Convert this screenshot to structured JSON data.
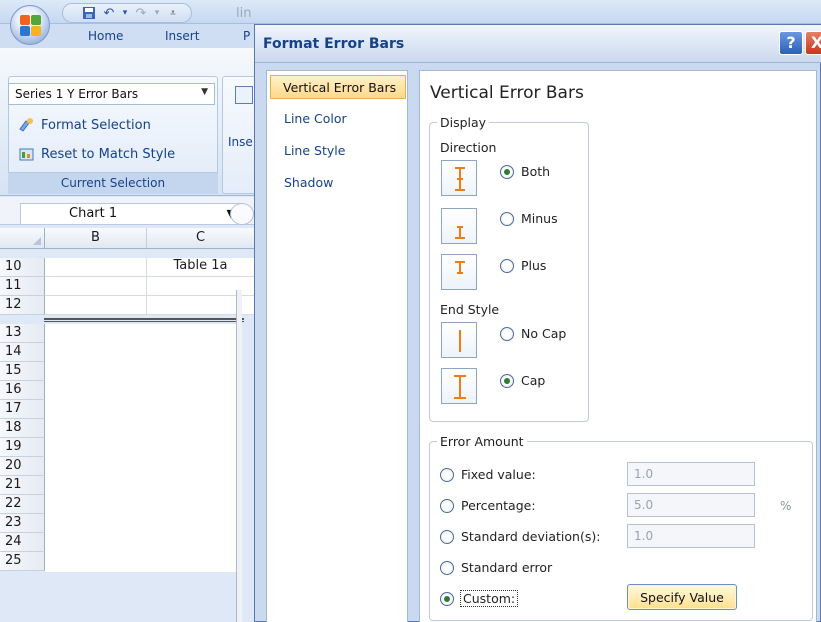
{
  "excel": {
    "doc_title": "lin",
    "tabs": [
      "Home",
      "Insert",
      "P"
    ],
    "current_selection": {
      "dropdown_value": "Series 1 Y Error Bars",
      "format_selection": "Format Selection",
      "reset_style": "Reset to Match Style",
      "group_label": "Current Selection"
    },
    "insert_label": "Inse",
    "name_box": "Chart 1",
    "columns": [
      "B",
      "C"
    ],
    "rows": [
      "10",
      "11",
      "12",
      "13",
      "14",
      "15",
      "16",
      "17",
      "18",
      "19",
      "20",
      "21",
      "22",
      "23",
      "24",
      "25"
    ],
    "cell_c10": "Table 1a"
  },
  "dialog": {
    "title": "Format Error Bars",
    "help_label": "?",
    "close_label": "X",
    "nav": [
      "Vertical Error Bars",
      "Line Color",
      "Line Style",
      "Shadow"
    ],
    "nav_selected": 0,
    "heading": "Vertical Error Bars",
    "display": {
      "legend": "Display",
      "direction_label": "Direction",
      "direction_options": [
        "Both",
        "Minus",
        "Plus"
      ],
      "direction_selected": "Both",
      "end_style_label": "End Style",
      "end_style_options": [
        "No Cap",
        "Cap"
      ],
      "end_style_selected": "Cap"
    },
    "error_amount": {
      "legend": "Error Amount",
      "fixed_value": {
        "label": "Fixed value:",
        "value": "1.0"
      },
      "percentage": {
        "label": "Percentage:",
        "value": "5.0",
        "unit": "%"
      },
      "std_dev": {
        "label": "Standard deviation(s):",
        "value": "1.0"
      },
      "std_error": {
        "label": "Standard error"
      },
      "custom": {
        "label": "Custom:"
      },
      "selected": "Custom",
      "specify_value_button": "Specify Value"
    }
  },
  "colors": {
    "accent_orange": "#f07d10",
    "title_blue": "#15428b",
    "radio_green": "#2f7b2f"
  }
}
